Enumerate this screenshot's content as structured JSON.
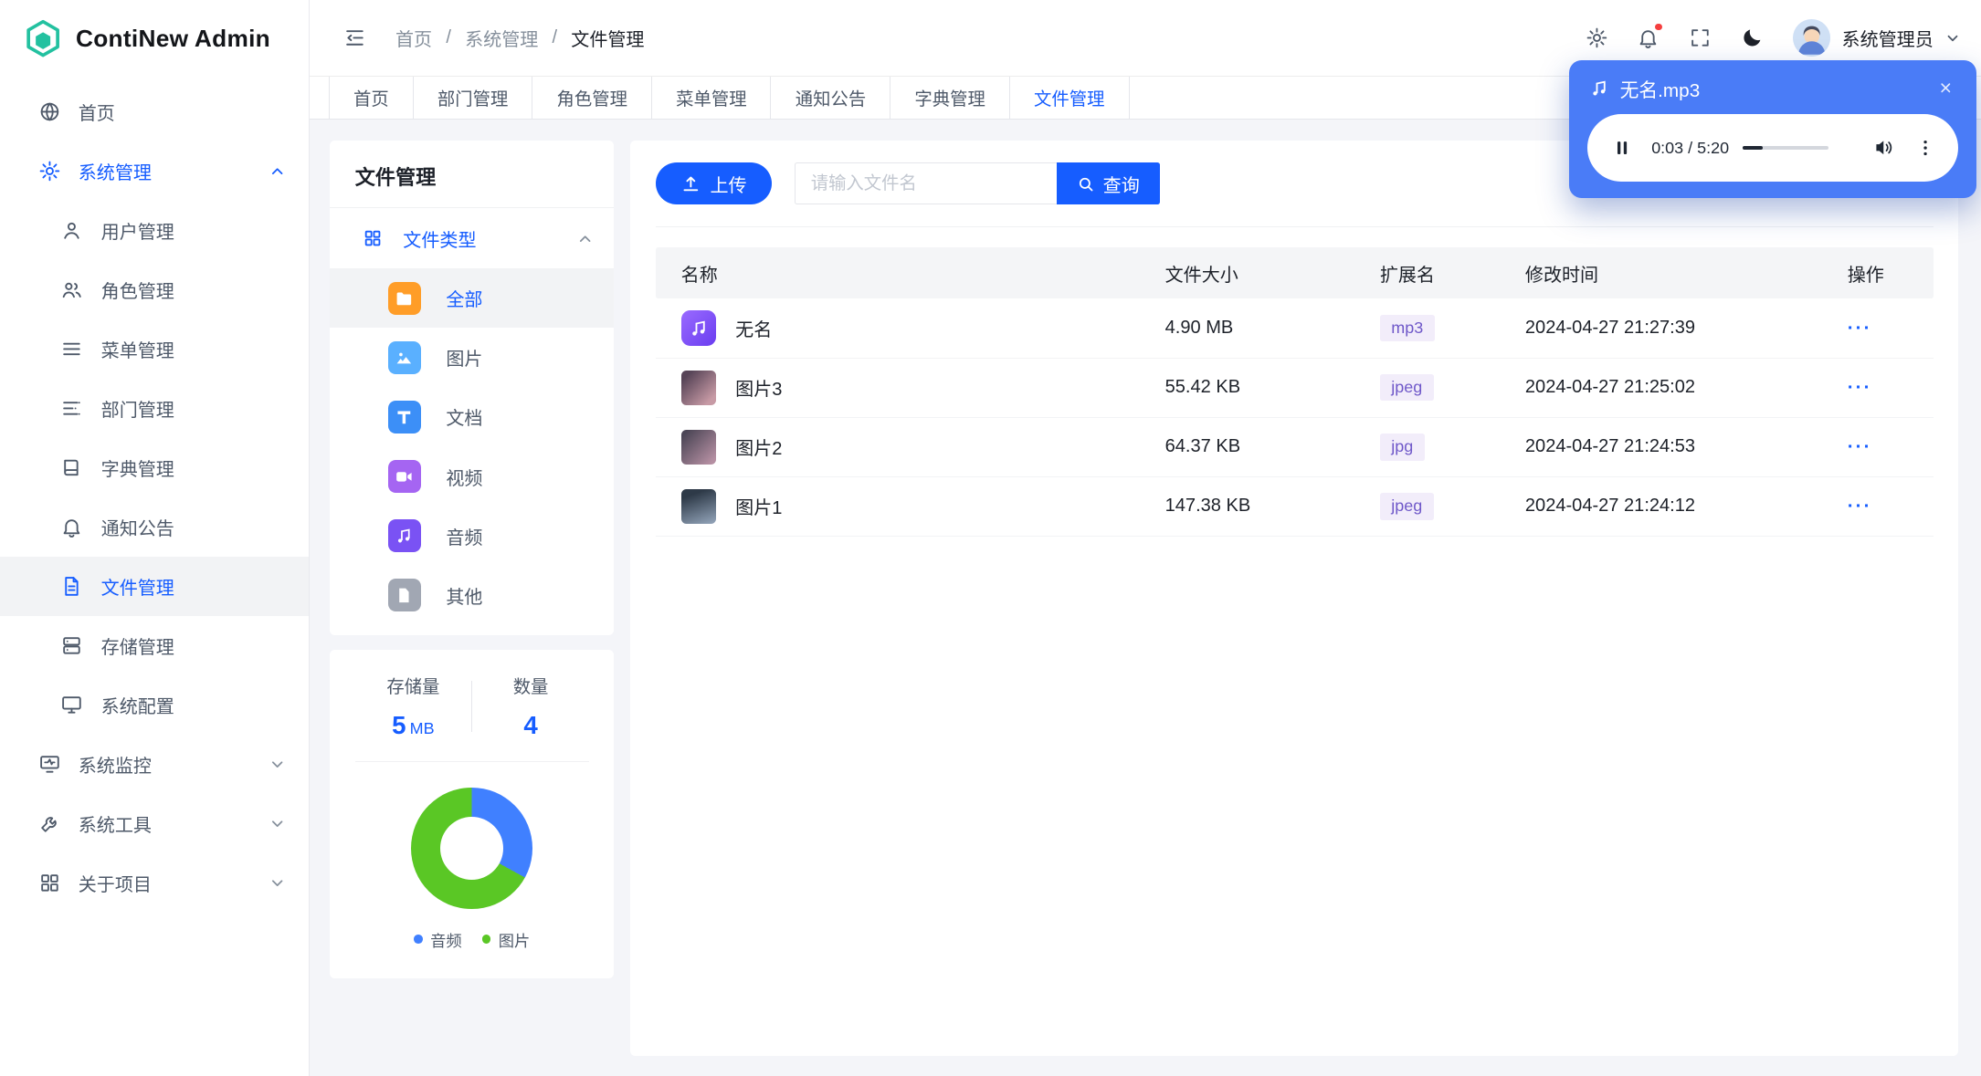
{
  "app": {
    "name": "ContiNew Admin"
  },
  "colors": {
    "primary": "#165DFF",
    "player_background": "#4A7CF7",
    "tag_background": "#F2EDFA",
    "tag_text": "#6F58C9",
    "notification_dot": "#F53F3F",
    "sidebar_active_background": "#F2F3F5"
  },
  "header": {
    "breadcrumb": {
      "separator": "/",
      "items": [
        "首页",
        "系统管理",
        "文件管理"
      ]
    },
    "user": {
      "name": "系统管理员"
    }
  },
  "tabbar": {
    "tabs": [
      "首页",
      "部门管理",
      "角色管理",
      "菜单管理",
      "通知公告",
      "字典管理",
      "文件管理"
    ],
    "active": "文件管理"
  },
  "sidebar": {
    "home": "首页",
    "system": "系统管理",
    "system_children": [
      "用户管理",
      "角色管理",
      "菜单管理",
      "部门管理",
      "字典管理",
      "通知公告",
      "文件管理",
      "存储管理",
      "系统配置"
    ],
    "active_item": "文件管理",
    "monitor": "系统监控",
    "tools": "系统工具",
    "about": "关于项目"
  },
  "filetypes": {
    "title": "文件管理",
    "section": "文件类型",
    "active": "全部",
    "types": [
      {
        "label": "全部",
        "icon": "folder-icon",
        "color": "#FF9D28"
      },
      {
        "label": "图片",
        "icon": "image-icon",
        "color": "#5AB0FF"
      },
      {
        "label": "文档",
        "icon": "document-icon",
        "color": "#3C8FF7"
      },
      {
        "label": "视频",
        "icon": "video-icon",
        "color": "#A565F2"
      },
      {
        "label": "音频",
        "icon": "music-icon",
        "color": "#7A52F4"
      },
      {
        "label": "其他",
        "icon": "file-icon",
        "color": "#A1A7B3"
      }
    ]
  },
  "storage_panel": {
    "storage_label": "存储量",
    "storage_value": "5",
    "storage_unit": "MB",
    "count_label": "数量",
    "count_value": "4",
    "chart": {
      "type": "pie",
      "segments": [
        {
          "label": "音频",
          "color": "#4080FF",
          "percent": 33
        },
        {
          "label": "图片",
          "color": "#5AC725",
          "percent": 67
        }
      ]
    }
  },
  "toolbar": {
    "upload_label": "上传",
    "search_placeholder": "请输入文件名",
    "query_label": "查询"
  },
  "table": {
    "headers": [
      "名称",
      "文件大小",
      "扩展名",
      "修改时间",
      "操作"
    ],
    "action_dots": "···",
    "rows": [
      {
        "name": "无名",
        "size": "4.90 MB",
        "ext": "mp3",
        "time": "2024-04-27 21:27:39",
        "icon": "music-file-icon"
      },
      {
        "name": "图片3",
        "size": "55.42 KB",
        "ext": "jpeg",
        "time": "2024-04-27 21:25:02",
        "icon": "image-thumbnail"
      },
      {
        "name": "图片2",
        "size": "64.37 KB",
        "ext": "jpg",
        "time": "2024-04-27 21:24:53",
        "icon": "image-thumbnail"
      },
      {
        "name": "图片1",
        "size": "147.38 KB",
        "ext": "jpeg",
        "time": "2024-04-27 21:24:12",
        "icon": "image-thumbnail"
      }
    ]
  },
  "player": {
    "title": "无名.mp3",
    "time_display": "0:03 / 5:20"
  }
}
